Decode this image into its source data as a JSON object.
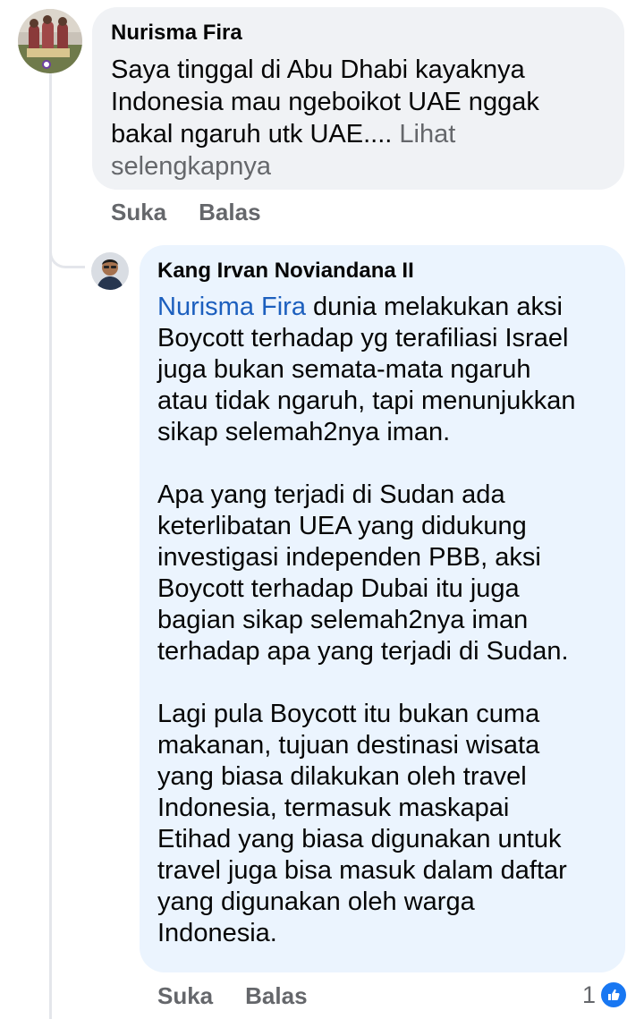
{
  "comments": [
    {
      "author": "Nurisma Fira",
      "text": "Saya tinggal di Abu Dhabi kayaknya\nIndonesia mau ngeboikot UAE nggak\nbakal ngaruh utk UAE.... ",
      "see_more": "Lihat\nselengkapnya",
      "actions": {
        "like": "Suka",
        "reply": "Balas"
      }
    },
    {
      "author": "Kang Irvan Noviandana II",
      "mention": "Nurisma Fira",
      "text": " dunia melakukan aksi\nBoycott terhadap yg terafiliasi Israel\njuga bukan semata-mata ngaruh\natau tidak ngaruh, tapi menunjukkan\nsikap selemah2nya iman.\n\nApa yang terjadi di Sudan ada\nketerlibatan UEA yang didukung\ninvestigasi independen PBB, aksi\nBoycott terhadap Dubai itu juga\nbagian sikap selemah2nya iman\nterhadap apa yang terjadi di Sudan.\n\nLagi pula Boycott itu bukan cuma\nmakanan, tujuan destinasi wisata\nyang biasa dilakukan oleh travel\nIndonesia, termasuk maskapai\nEtihad yang biasa digunakan untuk\ntravel juga bisa masuk dalam daftar\nyang digunakan oleh warga\nIndonesia.",
      "actions": {
        "like": "Suka",
        "reply": "Balas"
      },
      "reaction_count": "1",
      "reaction_icon": "like-icon"
    }
  ],
  "colors": {
    "bubble_gray": "#f0f2f5",
    "bubble_blue": "#ebf4fe",
    "mention": "#1c5fbe",
    "muted": "#65676b",
    "like_blue": "#1877f2"
  }
}
